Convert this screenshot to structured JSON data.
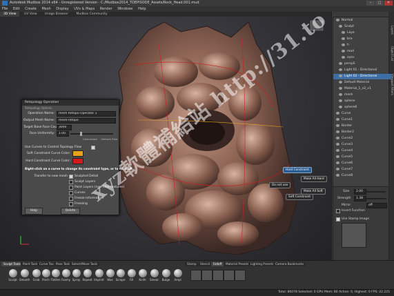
{
  "window": {
    "title": "Autodesk Mudbox 2014 x64 - Unregistered Version - C:/Mudbox2014_TOEPISODE_Assets/Rock_Head.001.mud",
    "buttons": [
      "–",
      "□",
      "✕"
    ]
  },
  "menubar": [
    "File",
    "Edit",
    "Create",
    "Mesh",
    "Display",
    "UVs & Maps",
    "Render",
    "Windows",
    "Help"
  ],
  "view_tabs": [
    "3D View",
    "UV View",
    "Image Browser",
    "Mudbox Community"
  ],
  "outliner": {
    "items": [
      {
        "label": "Normal",
        "selected": false
      },
      {
        "label": "Sculpt",
        "selected": false
      },
      {
        "label": "Laye",
        "selected": false
      },
      {
        "label": "bra",
        "selected": false
      },
      {
        "label": "h",
        "selected": false
      },
      {
        "label": "mod",
        "selected": false
      },
      {
        "label": "eyes",
        "selected": false
      },
      {
        "label": "perspS",
        "selected": false
      },
      {
        "label": "Light 01 - Directional",
        "selected": false
      },
      {
        "label": "Light 02 - Directional",
        "selected": true
      },
      {
        "label": "Default Material",
        "selected": false
      },
      {
        "label": "Material_1_v2_v1",
        "selected": false
      },
      {
        "label": "mesh",
        "selected": false
      },
      {
        "label": "sphere",
        "selected": false
      },
      {
        "label": "sphere6",
        "selected": false
      },
      {
        "label": "Curve",
        "selected": false
      },
      {
        "label": "Curve1",
        "selected": false
      },
      {
        "label": "Border",
        "selected": false
      },
      {
        "label": "Border2",
        "selected": false
      },
      {
        "label": "Curve2",
        "selected": false
      },
      {
        "label": "Curve3",
        "selected": false
      },
      {
        "label": "Curve4",
        "selected": false
      },
      {
        "label": "Curve5",
        "selected": false
      },
      {
        "label": "Curve6",
        "selected": false
      },
      {
        "label": "Curve7",
        "selected": false
      },
      {
        "label": "Curve8",
        "selected": false
      }
    ]
  },
  "sidebar_tabs": [
    "Layers",
    "Object List",
    "Viewport Filters"
  ],
  "properties": {
    "size_label": "Size",
    "size_value": "2.00",
    "strength_label": "Strength",
    "strength_value": "1.38",
    "mirror_label": "Mirror",
    "mirror_value": "off",
    "invert_label": "Invert Function",
    "stamp_label": "Use Stamp Image"
  },
  "dialog": {
    "title": "Retopology Operation",
    "title_sub": "Retopology Options",
    "operation_name_label": "Operation Name:",
    "operation_name_value": "mesh Retopo Operator 1",
    "output_mesh_label": "Output Mesh Name:",
    "output_mesh_value": "mesh-retopo",
    "target_face_label": "Target Base Face Count:",
    "target_face_value": "3000",
    "face_uniformity_label": "Face Uniformity:",
    "face_uniformity_value": "1.00",
    "slider_left": "Unstrained",
    "slider_right": "Uniform Size",
    "use_curves_label": "Use Curves to Control Topology Flow",
    "soft_color_label": "Soft Constraint Curve Color:",
    "hard_color_label": "Hard Constraint Curve Color:",
    "soft_color": "#e8a21a",
    "hard_color": "#d11a1a",
    "hint": "Right-click on a curve to change its constraint type, or to fix it off.",
    "transfer_label": "Transfer to new mesh",
    "options": [
      {
        "label": "Sculpted Detail",
        "checked": true
      },
      {
        "label": "Sculpt Layers",
        "checked": false
      },
      {
        "label": "Paint Layers (non-tiled textures)",
        "checked": false
      },
      {
        "label": "Curves",
        "checked": false
      },
      {
        "label": "Freeze Information",
        "checked": false
      },
      {
        "label": "Freezing",
        "checked": false
      }
    ],
    "help_button": "Help",
    "delete_button": "Delete"
  },
  "viewport_callouts": [
    {
      "label": "Hard Constraint",
      "highlight": true
    },
    {
      "label": "Make All Hard",
      "highlight": false
    },
    {
      "label": "Do not use",
      "highlight": false
    },
    {
      "label": "Make All Soft",
      "highlight": false
    },
    {
      "label": "Soft Constraint",
      "highlight": false
    }
  ],
  "tray_tabs_left": [
    "Sculpt Tools",
    "Paint Tools",
    "Curve Tools",
    "Pose Tools",
    "Select/Move Tools"
  ],
  "tray_tabs_right": [
    "Stamp",
    "Stencil",
    "Falloff",
    "Material Presets",
    "Lighting Presets",
    "Camera Bookmarks"
  ],
  "active_left_tab": "Sculpt Tools",
  "active_right_tab": "Falloff",
  "tools": [
    "Sculpt",
    "Smooth",
    "Grab",
    "Pinch",
    "Flatten",
    "Foamy",
    "Spray",
    "Repeat",
    "Imprint",
    "Wax",
    "Scrape",
    "Fill",
    "Knife",
    "Smear",
    "Bulge",
    "Ampl"
  ],
  "statusbar": "Total: 86078   Selected: 0   GPU Mem: 80   Active: 0, Highest: 0   FPS: 22.225",
  "watermark": "xyz軟體補給站 http://31.to"
}
